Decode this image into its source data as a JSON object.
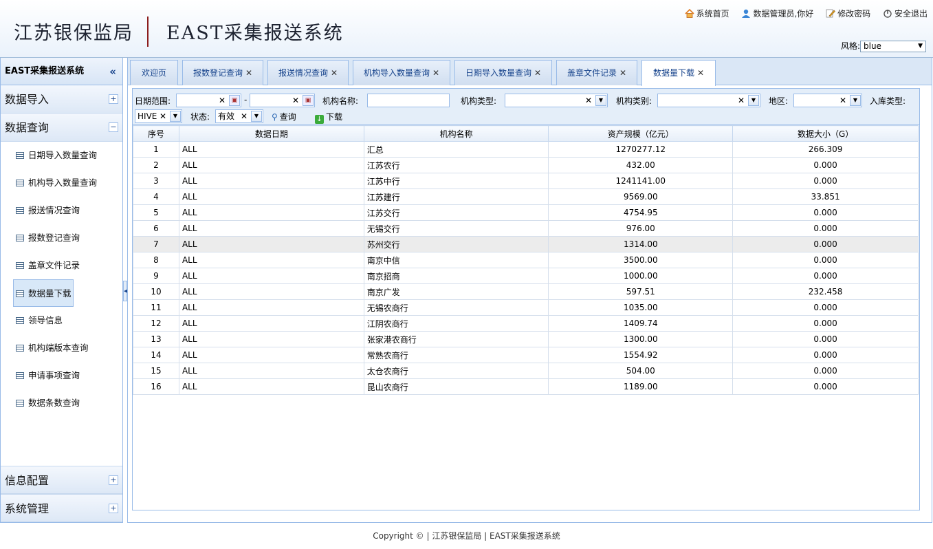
{
  "header": {
    "org": "江苏银保监局",
    "system": "EAST采集报送系统",
    "links": [
      {
        "icon": "home-icon",
        "label": "系统首页"
      },
      {
        "icon": "user-icon",
        "label": "数据管理员,你好"
      },
      {
        "icon": "edit-icon",
        "label": "修改密码"
      },
      {
        "icon": "power-icon",
        "label": "安全退出"
      }
    ],
    "style_label": "风格:",
    "style_value": "blue"
  },
  "sidebar": {
    "title": "EAST采集报送系统",
    "collapse": "«",
    "groups": [
      {
        "label": "数据导入",
        "toggle": "+"
      },
      {
        "label": "数据查询",
        "toggle": "−"
      }
    ],
    "items": [
      "日期导入数量查询",
      "机构导入数量查询",
      "报送情况查询",
      "报数登记查询",
      "盖章文件记录",
      "数据量下载",
      "领导信息",
      "机构端版本查询",
      "申请事项查询",
      "数据条数查询"
    ],
    "bottom_groups": [
      {
        "label": "信息配置",
        "toggle": "+"
      },
      {
        "label": "系统管理",
        "toggle": "+"
      }
    ]
  },
  "tabs": [
    {
      "label": "欢迎页",
      "close": ""
    },
    {
      "label": "报数登记查询",
      "close": "✕"
    },
    {
      "label": "报送情况查询",
      "close": "✕"
    },
    {
      "label": "机构导入数量查询",
      "close": "✕"
    },
    {
      "label": "日期导入数量查询",
      "close": "✕"
    },
    {
      "label": "盖章文件记录",
      "close": "✕"
    },
    {
      "label": "数据量下载",
      "close": "✕"
    }
  ],
  "filter": {
    "date_range_label": "日期范围:",
    "dash": "-",
    "org_name_label": "机构名称:",
    "org_type_label": "机构类型:",
    "org_category_label": "机构类别:",
    "region_label": "地区:",
    "storage_type_label": "入库类型:",
    "storage_type_value": "HIVE",
    "status_label": "状态:",
    "status_value": "有效",
    "clear": "✕",
    "query_label": "查询",
    "download_label": "下载"
  },
  "table": {
    "columns": [
      "序号",
      "数据日期",
      "机构名称",
      "资产规模（亿元）",
      "数据大小（G）"
    ],
    "rows": [
      [
        "1",
        "ALL",
        "汇总",
        "1270277.12",
        "266.309"
      ],
      [
        "2",
        "ALL",
        "江苏农行",
        "432.00",
        "0.000"
      ],
      [
        "3",
        "ALL",
        "江苏中行",
        "1241141.00",
        "0.000"
      ],
      [
        "4",
        "ALL",
        "江苏建行",
        "9569.00",
        "33.851"
      ],
      [
        "5",
        "ALL",
        "江苏交行",
        "4754.95",
        "0.000"
      ],
      [
        "6",
        "ALL",
        "无锡交行",
        "976.00",
        "0.000"
      ],
      [
        "7",
        "ALL",
        "苏州交行",
        "1314.00",
        "0.000"
      ],
      [
        "8",
        "ALL",
        "南京中信",
        "3500.00",
        "0.000"
      ],
      [
        "9",
        "ALL",
        "南京招商",
        "1000.00",
        "0.000"
      ],
      [
        "10",
        "ALL",
        "南京广发",
        "597.51",
        "232.458"
      ],
      [
        "11",
        "ALL",
        "无锡农商行",
        "1035.00",
        "0.000"
      ],
      [
        "12",
        "ALL",
        "江阴农商行",
        "1409.74",
        "0.000"
      ],
      [
        "13",
        "ALL",
        "张家港农商行",
        "1300.00",
        "0.000"
      ],
      [
        "14",
        "ALL",
        "常熟农商行",
        "1554.92",
        "0.000"
      ],
      [
        "15",
        "ALL",
        "太仓农商行",
        "504.00",
        "0.000"
      ],
      [
        "16",
        "ALL",
        "昆山农商行",
        "1189.00",
        "0.000"
      ]
    ]
  },
  "footer": "Copyright © | 江苏银保监局 | EAST采集报送系统"
}
